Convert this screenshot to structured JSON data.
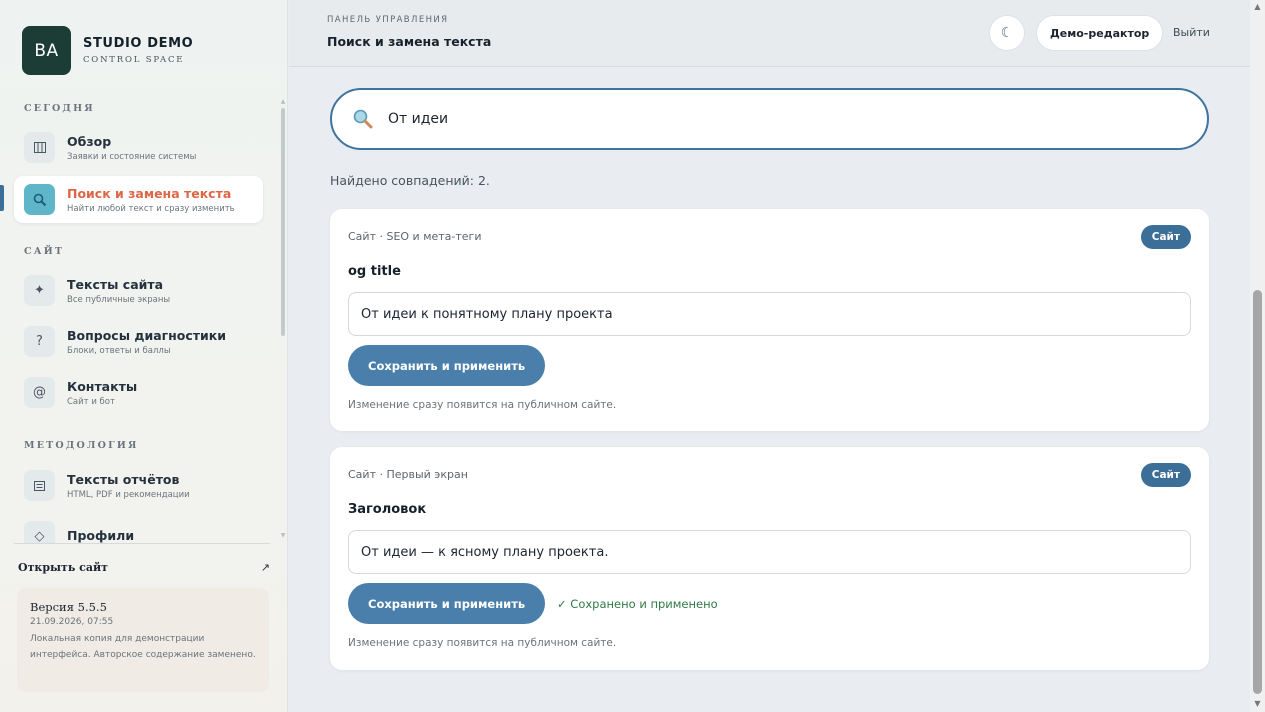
{
  "brand": {
    "logo_text": "BA",
    "name": "STUDIO DEMO",
    "subtitle": "CONTROL SPACE"
  },
  "sidebar": {
    "sections": {
      "today": "СЕГОДНЯ",
      "site": "САЙТ",
      "methodology": "МЕТОДОЛОГИЯ"
    },
    "items": [
      {
        "title": "Обзор",
        "subtitle": "Заявки и состояние системы",
        "icon": "grid-icon"
      },
      {
        "title": "Поиск и замена текста",
        "subtitle": "Найти любой текст и сразу изменить",
        "icon": "search-icon",
        "active": true
      },
      {
        "title": "Тексты сайта",
        "subtitle": "Все публичные экраны",
        "icon": "sparkle-icon"
      },
      {
        "title": "Вопросы диагностики",
        "subtitle": "Блоки, ответы и баллы",
        "icon": "question-icon"
      },
      {
        "title": "Контакты",
        "subtitle": "Сайт и бот",
        "icon": "at-icon"
      },
      {
        "title": "Тексты отчётов",
        "subtitle": "HTML, PDF и рекомендации",
        "icon": "document-icon"
      },
      {
        "title": "Профили",
        "subtitle": "",
        "icon": "diamond-icon"
      }
    ],
    "open_site": {
      "label": "Открыть сайт",
      "arrow": "↗"
    },
    "version": {
      "title": "Версия 5.5.5",
      "date": "21.09.2026, 07:55",
      "note": "Локальная копия для демонстрации интерфейса. Авторское содержание заменено."
    }
  },
  "header": {
    "eyebrow": "ПАНЕЛЬ УПРАВЛЕНИЯ",
    "title": "Поиск и замена текста",
    "theme_icon": "☾",
    "user_label": "Демо-редактор",
    "logout_label": "Выйти"
  },
  "search": {
    "value": "От идеи",
    "results_text": "Найдено совпадений: 2."
  },
  "results": [
    {
      "crumb": "Сайт · SEO и мета-теги",
      "badge": "Сайт",
      "field": "og title",
      "value": "От идеи к понятному плану проекта",
      "save_label": "Сохранить и применить",
      "status": "",
      "hint": "Изменение сразу появится на публичном сайте."
    },
    {
      "crumb": "Сайт · Первый экран",
      "badge": "Сайт",
      "field": "Заголовок",
      "value": "От идеи — к ясному плану проекта.",
      "save_label": "Сохранить и применить",
      "status": "✓ Сохранено и применено",
      "hint": "Изменение сразу появится на публичном сайте."
    }
  ],
  "colors": {
    "accent": "#3c6f98",
    "active_title": "#dd6646",
    "success": "#2f7a45",
    "brand_dark": "#1b3d35"
  }
}
